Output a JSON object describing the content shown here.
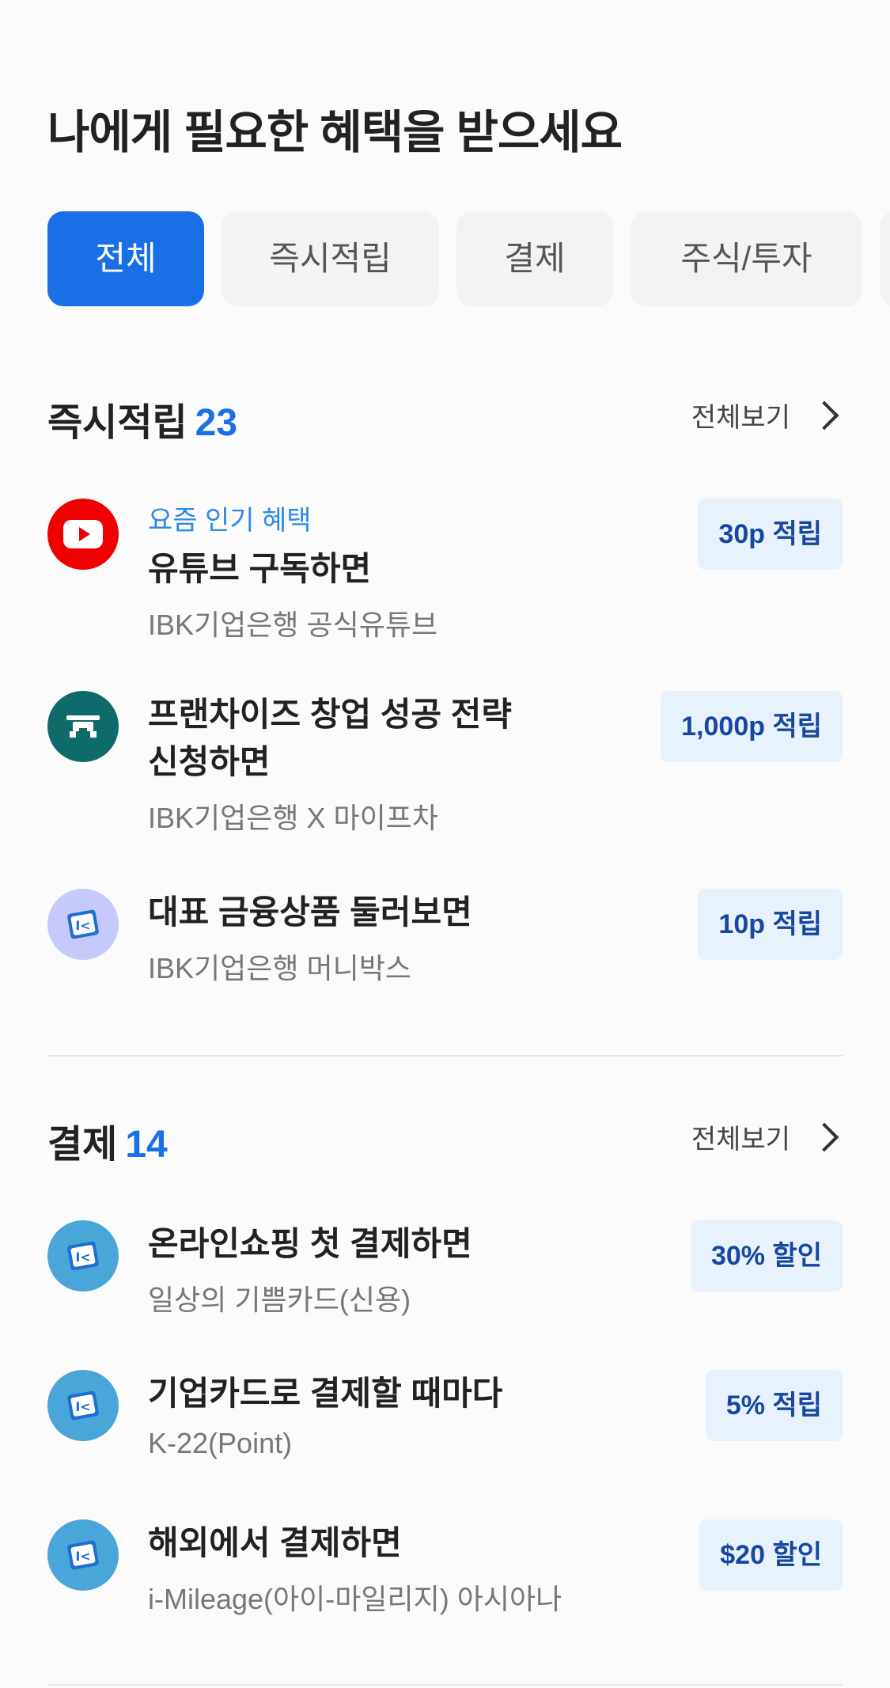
{
  "page_title": "나에게 필요한 혜택을 받으세요",
  "filters": [
    {
      "label": "전체",
      "active": true
    },
    {
      "label": "즉시적립",
      "active": false
    },
    {
      "label": "결제",
      "active": false
    },
    {
      "label": "주식/투자",
      "active": false
    }
  ],
  "sections": [
    {
      "title": "즉시적립",
      "count": "23",
      "see_all": "전체보기",
      "items": [
        {
          "icon": "youtube-icon",
          "eyebrow": "요즘 인기 혜택",
          "title": "유튜브 구독하면",
          "subtitle": "IBK기업은행 공식유튜브",
          "badge": "30p 적립"
        },
        {
          "icon": "franchise-icon",
          "title": "프랜차이즈 창업 성공 전략\n신청하면",
          "subtitle": "IBK기업은행 X 마이프차",
          "badge": "1,000p 적립"
        },
        {
          "icon": "ibk-card-icon",
          "title": "대표 금융상품 둘러보면",
          "subtitle": "IBK기업은행 머니박스",
          "badge": "10p 적립"
        }
      ]
    },
    {
      "title": "결제",
      "count": "14",
      "see_all": "전체보기",
      "items": [
        {
          "icon": "ibk-card-icon",
          "title": "온라인쇼핑 첫 결제하면",
          "subtitle": "일상의 기쁨카드(신용)",
          "badge": "30% 할인"
        },
        {
          "icon": "ibk-card-icon",
          "title": "기업카드로 결제할 때마다",
          "subtitle": "K-22(Point)",
          "badge": "5% 적립"
        },
        {
          "icon": "ibk-card-icon",
          "title": "해외에서 결제하면",
          "subtitle": "i-Mileage(아이-마일리지) 아시아나",
          "badge": "$20 할인"
        }
      ]
    }
  ],
  "colors": {
    "accent": "#1b6fe6",
    "badge_bg": "#e8f2fd",
    "badge_text": "#17479e",
    "youtube": "#ee0000",
    "franchise": "#0f6b6a",
    "ibk_blue": "#4aa6d8",
    "ibk_violet": "#c6c9fb"
  }
}
